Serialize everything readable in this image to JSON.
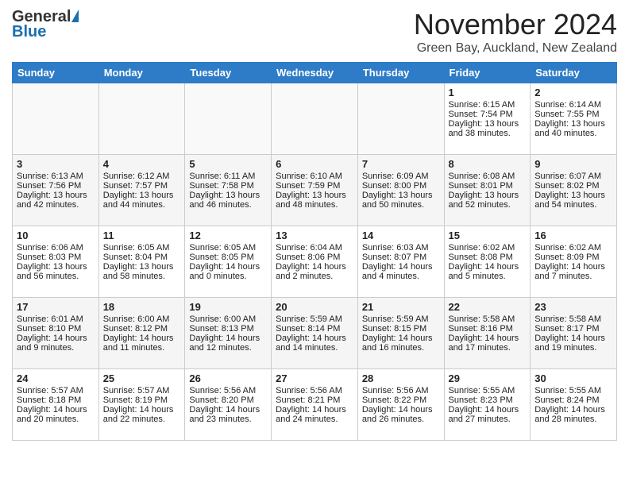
{
  "header": {
    "logo_general": "General",
    "logo_blue": "Blue",
    "month_title": "November 2024",
    "subtitle": "Green Bay, Auckland, New Zealand"
  },
  "days_of_week": [
    "Sunday",
    "Monday",
    "Tuesday",
    "Wednesday",
    "Thursday",
    "Friday",
    "Saturday"
  ],
  "weeks": [
    [
      {
        "day": null,
        "data": null
      },
      {
        "day": null,
        "data": null
      },
      {
        "day": null,
        "data": null
      },
      {
        "day": null,
        "data": null
      },
      {
        "day": null,
        "data": null
      },
      {
        "day": "1",
        "sunrise": "6:15 AM",
        "sunset": "7:54 PM",
        "daylight": "13 hours and 38 minutes."
      },
      {
        "day": "2",
        "sunrise": "6:14 AM",
        "sunset": "7:55 PM",
        "daylight": "13 hours and 40 minutes."
      }
    ],
    [
      {
        "day": "3",
        "sunrise": "6:13 AM",
        "sunset": "7:56 PM",
        "daylight": "13 hours and 42 minutes."
      },
      {
        "day": "4",
        "sunrise": "6:12 AM",
        "sunset": "7:57 PM",
        "daylight": "13 hours and 44 minutes."
      },
      {
        "day": "5",
        "sunrise": "6:11 AM",
        "sunset": "7:58 PM",
        "daylight": "13 hours and 46 minutes."
      },
      {
        "day": "6",
        "sunrise": "6:10 AM",
        "sunset": "7:59 PM",
        "daylight": "13 hours and 48 minutes."
      },
      {
        "day": "7",
        "sunrise": "6:09 AM",
        "sunset": "8:00 PM",
        "daylight": "13 hours and 50 minutes."
      },
      {
        "day": "8",
        "sunrise": "6:08 AM",
        "sunset": "8:01 PM",
        "daylight": "13 hours and 52 minutes."
      },
      {
        "day": "9",
        "sunrise": "6:07 AM",
        "sunset": "8:02 PM",
        "daylight": "13 hours and 54 minutes."
      }
    ],
    [
      {
        "day": "10",
        "sunrise": "6:06 AM",
        "sunset": "8:03 PM",
        "daylight": "13 hours and 56 minutes."
      },
      {
        "day": "11",
        "sunrise": "6:05 AM",
        "sunset": "8:04 PM",
        "daylight": "13 hours and 58 minutes."
      },
      {
        "day": "12",
        "sunrise": "6:05 AM",
        "sunset": "8:05 PM",
        "daylight": "14 hours and 0 minutes."
      },
      {
        "day": "13",
        "sunrise": "6:04 AM",
        "sunset": "8:06 PM",
        "daylight": "14 hours and 2 minutes."
      },
      {
        "day": "14",
        "sunrise": "6:03 AM",
        "sunset": "8:07 PM",
        "daylight": "14 hours and 4 minutes."
      },
      {
        "day": "15",
        "sunrise": "6:02 AM",
        "sunset": "8:08 PM",
        "daylight": "14 hours and 5 minutes."
      },
      {
        "day": "16",
        "sunrise": "6:02 AM",
        "sunset": "8:09 PM",
        "daylight": "14 hours and 7 minutes."
      }
    ],
    [
      {
        "day": "17",
        "sunrise": "6:01 AM",
        "sunset": "8:10 PM",
        "daylight": "14 hours and 9 minutes."
      },
      {
        "day": "18",
        "sunrise": "6:00 AM",
        "sunset": "8:12 PM",
        "daylight": "14 hours and 11 minutes."
      },
      {
        "day": "19",
        "sunrise": "6:00 AM",
        "sunset": "8:13 PM",
        "daylight": "14 hours and 12 minutes."
      },
      {
        "day": "20",
        "sunrise": "5:59 AM",
        "sunset": "8:14 PM",
        "daylight": "14 hours and 14 minutes."
      },
      {
        "day": "21",
        "sunrise": "5:59 AM",
        "sunset": "8:15 PM",
        "daylight": "14 hours and 16 minutes."
      },
      {
        "day": "22",
        "sunrise": "5:58 AM",
        "sunset": "8:16 PM",
        "daylight": "14 hours and 17 minutes."
      },
      {
        "day": "23",
        "sunrise": "5:58 AM",
        "sunset": "8:17 PM",
        "daylight": "14 hours and 19 minutes."
      }
    ],
    [
      {
        "day": "24",
        "sunrise": "5:57 AM",
        "sunset": "8:18 PM",
        "daylight": "14 hours and 20 minutes."
      },
      {
        "day": "25",
        "sunrise": "5:57 AM",
        "sunset": "8:19 PM",
        "daylight": "14 hours and 22 minutes."
      },
      {
        "day": "26",
        "sunrise": "5:56 AM",
        "sunset": "8:20 PM",
        "daylight": "14 hours and 23 minutes."
      },
      {
        "day": "27",
        "sunrise": "5:56 AM",
        "sunset": "8:21 PM",
        "daylight": "14 hours and 24 minutes."
      },
      {
        "day": "28",
        "sunrise": "5:56 AM",
        "sunset": "8:22 PM",
        "daylight": "14 hours and 26 minutes."
      },
      {
        "day": "29",
        "sunrise": "5:55 AM",
        "sunset": "8:23 PM",
        "daylight": "14 hours and 27 minutes."
      },
      {
        "day": "30",
        "sunrise": "5:55 AM",
        "sunset": "8:24 PM",
        "daylight": "14 hours and 28 minutes."
      }
    ]
  ],
  "labels": {
    "sunrise": "Sunrise:",
    "sunset": "Sunset:",
    "daylight": "Daylight:"
  }
}
